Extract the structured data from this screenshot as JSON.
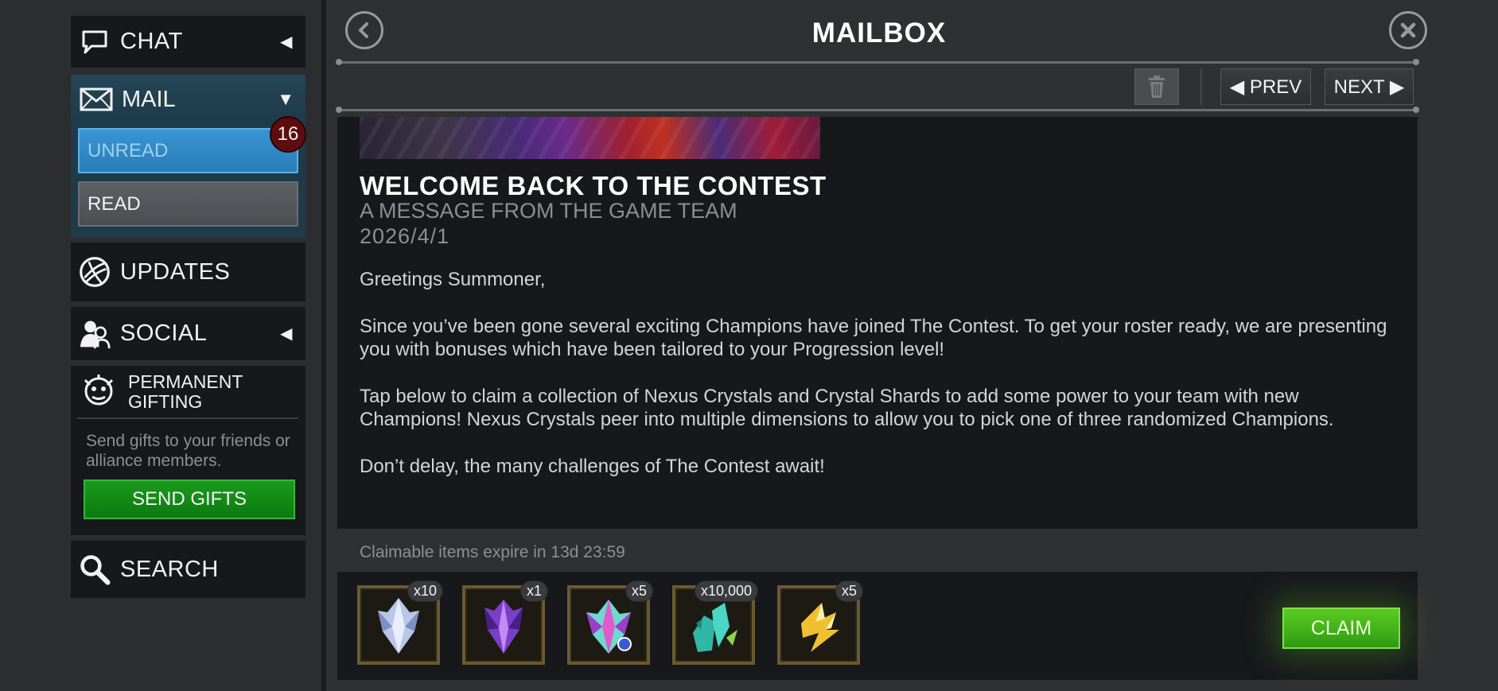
{
  "header": {
    "title": "MAILBOX"
  },
  "sidebar": {
    "chat_label": "CHAT",
    "mail_label": "MAIL",
    "unread_label": "UNREAD",
    "read_label": "READ",
    "unread_count": "16",
    "updates_label": "UPDATES",
    "social_label": "SOCIAL",
    "gifting_title": "PERMANENT GIFTING",
    "gifting_text": "Send gifts to your friends or alliance members.",
    "send_gifts_label": "SEND GIFTS",
    "search_label": "SEARCH"
  },
  "toolbar": {
    "prev_label": "◀ PREV",
    "next_label": "NEXT ▶"
  },
  "message": {
    "title": "WELCOME BACK TO THE CONTEST",
    "subtitle": "A MESSAGE FROM THE GAME TEAM",
    "date": "2026/4/1",
    "paragraphs": [
      "Greetings Summoner,",
      "Since you’ve been gone several exciting Champions have joined The Contest. To get your roster ready, we are presenting you with bonuses which have been tailored to your Progression level!",
      "Tap below to claim a collection of Nexus Crystals and Crystal Shards to add some power to your team with new Champions! Nexus Crystals peer into multiple dimensions to allow you to pick one of three randomized Champions.",
      "Don’t delay, the many challenges of The Contest await!"
    ]
  },
  "rewards": {
    "expire_text": "Claimable items expire in 13d 23:59",
    "items": [
      {
        "icon": "crystal-shard-icon",
        "qty": "x10"
      },
      {
        "icon": "purple-crystal-icon",
        "qty": "x1"
      },
      {
        "icon": "nexus-crystal-icon",
        "qty": "x5"
      },
      {
        "icon": "shards-icon",
        "qty": "x10,000"
      },
      {
        "icon": "gold-shard-icon",
        "qty": "x5"
      }
    ],
    "claim_label": "CLAIM"
  },
  "colors": {
    "accent_blue": "#2a7db8",
    "claim_green": "#3fae16",
    "send_green": "#0d7a10",
    "badge_red": "#5e0d0f"
  }
}
